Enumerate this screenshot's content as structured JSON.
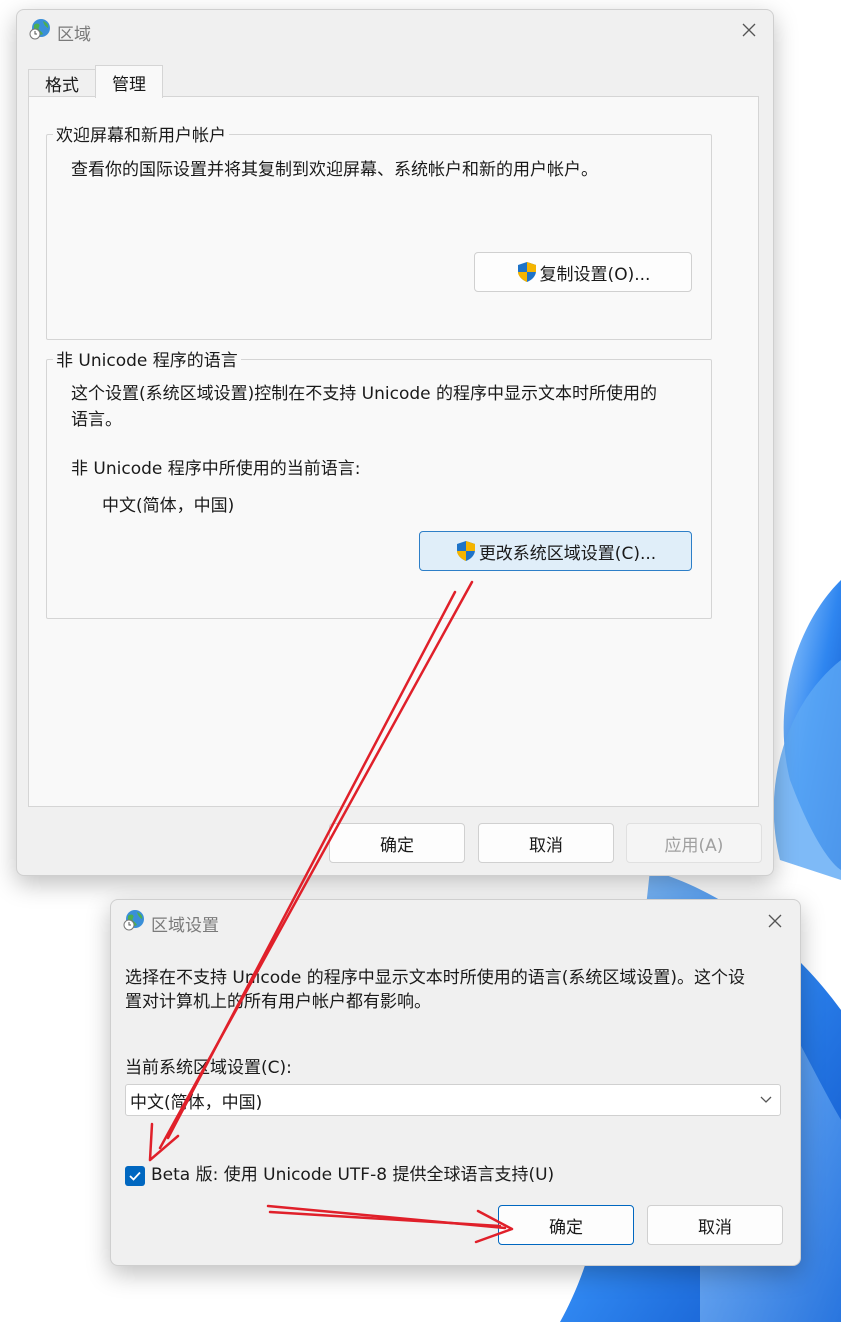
{
  "region_window": {
    "title": "区域",
    "tabs": [
      {
        "label": "格式",
        "active": false
      },
      {
        "label": "管理",
        "active": true
      }
    ],
    "welcome_group": {
      "label": "欢迎屏幕和新用户帐户",
      "description": "查看你的国际设置并将其复制到欢迎屏幕、系统帐户和新的用户帐户。",
      "copy_button": "复制设置(O)..."
    },
    "non_unicode_group": {
      "label": "非 Unicode 程序的语言",
      "description_line1": "这个设置(系统区域设置)控制在不支持 Unicode 的程序中显示文本时所使用的",
      "description_line2": "语言。",
      "current_label": "非 Unicode 程序中所使用的当前语言:",
      "current_value": "中文(简体，中国)",
      "change_button": "更改系统区域设置(C)..."
    },
    "buttons": {
      "ok": "确定",
      "cancel": "取消",
      "apply": "应用(A)"
    }
  },
  "region_settings_dialog": {
    "title": "区域设置",
    "description_line1": "选择在不支持 Unicode 的程序中显示文本时所使用的语言(系统区域设置)。这个设",
    "description_line2": "置对计算机上的所有用户帐户都有影响。",
    "locale_label": "当前系统区域设置(C):",
    "locale_value": "中文(简体，中国)",
    "beta_checkbox": {
      "label": "Beta 版: 使用 Unicode UTF-8 提供全球语言支持(U)",
      "checked": true
    },
    "buttons": {
      "ok": "确定",
      "cancel": "取消"
    }
  },
  "icons": {
    "title_icon": "globe-clock-icon",
    "close": "close-icon",
    "uac": "uac-shield-icon",
    "dropdown": "chevron-down-icon",
    "check": "checkmark-icon"
  },
  "colors": {
    "accent": "#0067c0",
    "arrow": "#e0202a",
    "window_bg": "#f0f0f0",
    "panel_bg": "#f9f9f9",
    "wallpaper_blue": "#1e6fd9"
  }
}
